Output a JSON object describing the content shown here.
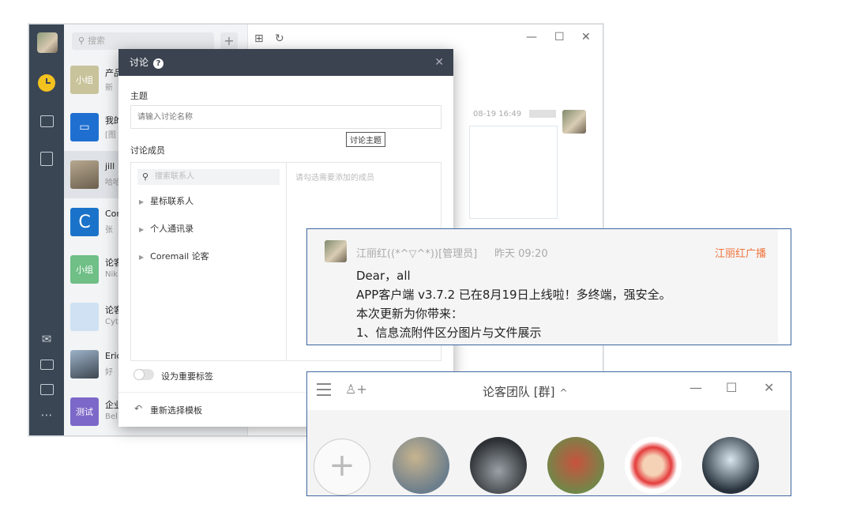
{
  "sidebar": {
    "search_placeholder": "搜索",
    "add_label": "+",
    "conversations": [
      {
        "name": "产品",
        "sub": "新",
        "avatar_text": "小组",
        "avatar_color": "#c8c39a"
      },
      {
        "name": "我的",
        "sub": "[图",
        "avatar_text": "",
        "avatar_color": "#1f6fd0"
      },
      {
        "name": "jill",
        "sub": "哈哈",
        "avatar_text": "",
        "avatar_color": "#a89c88"
      },
      {
        "name": "Cor",
        "sub": "张",
        "avatar_text": "C",
        "avatar_color": "#1a73c9"
      },
      {
        "name": "论客",
        "sub": "Nik",
        "avatar_text": "小组",
        "avatar_color": "#6fbf86"
      },
      {
        "name": "论客",
        "sub": "Cyt",
        "avatar_text": "",
        "avatar_color": "#cfe1f3"
      },
      {
        "name": "Eric",
        "sub": "好",
        "avatar_text": "",
        "avatar_color": "#5a6470"
      },
      {
        "name": "企业",
        "sub": "Bel",
        "avatar_text": "测试",
        "avatar_color": "#7b68c8"
      }
    ]
  },
  "chat": {
    "time": "08-19 16:49"
  },
  "dialog": {
    "title": "讨论",
    "help": "?",
    "close": "✕",
    "topic_label": "主题",
    "topic_placeholder": "请输入讨论名称",
    "tooltip": "讨论主题",
    "members_label": "讨论成员",
    "members_search_placeholder": "搜索联系人",
    "tree": [
      "星标联系人",
      "个人通讯录",
      "Coremail 论客"
    ],
    "members_hint": "请勾选需要添加的成员",
    "important_label": "设为重要标签",
    "reset_label": "重新选择模板"
  },
  "notice": {
    "sender": "江丽红((*^▽^*))[管理员]",
    "time": "昨天 09:20",
    "tag": "江丽红广播",
    "lines": [
      "Dear，all",
      "APP客户端 v3.7.2 已在8月19日上线啦！多终端，强安全。",
      "本次更新为你带来：",
      "1、信息流附件区分图片与文件展示"
    ]
  },
  "group": {
    "title": "论客团队 [群]",
    "chevron": "^",
    "add_symbol": "+"
  },
  "colors": {
    "rail": "#3a4654",
    "dialog_header": "#3b4350",
    "popup_border": "#3f67a0",
    "notice_tag": "#f0743c"
  }
}
